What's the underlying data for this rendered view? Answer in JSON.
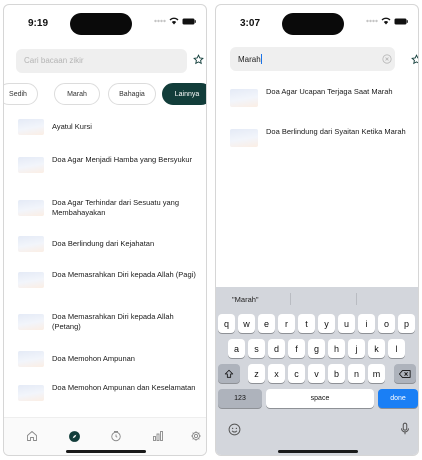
{
  "screen1": {
    "status_time": "9:19",
    "search_placeholder": "Cari bacaan zikir",
    "chips": [
      {
        "label": "Sedih"
      },
      {
        "label": "Marah"
      },
      {
        "label": "Bahagia"
      },
      {
        "label": "Lainnya",
        "active": true
      }
    ],
    "items": [
      {
        "title": "Ayatul Kursi"
      },
      {
        "title": "Doa Agar Menjadi Hamba yang Bersyukur"
      },
      {
        "title": "Doa Agar Terhindar dari Sesuatu yang Membahayakan"
      },
      {
        "title": "Doa Berlindung dari Kejahatan"
      },
      {
        "title": "Doa Memasrahkan Diri kepada Allah (Pagi)"
      },
      {
        "title": "Doa Memasrahkan Diri kepada Allah (Petang)"
      },
      {
        "title": "Doa Memohon Ampunan"
      },
      {
        "title": "Doa Memohon Ampunan dan Keselamatan"
      }
    ],
    "tabs": [
      {
        "icon": "home-icon"
      },
      {
        "icon": "compass-icon",
        "active": true
      },
      {
        "icon": "clock-icon"
      },
      {
        "icon": "stats-icon"
      },
      {
        "icon": "gear-icon"
      }
    ]
  },
  "screen2": {
    "status_time": "3:07",
    "search_value": "Marah",
    "results": [
      {
        "title": "Doa Agar Ucapan Terjaga Saat Marah"
      },
      {
        "title": "Doa Berlindung dari Syaitan Ketika Marah"
      }
    ],
    "keyboard": {
      "suggestion": "\"Marah\"",
      "row1": [
        "q",
        "w",
        "e",
        "r",
        "t",
        "y",
        "u",
        "i",
        "o",
        "p"
      ],
      "row2": [
        "a",
        "s",
        "d",
        "f",
        "g",
        "h",
        "j",
        "k",
        "l"
      ],
      "row3": [
        "z",
        "x",
        "c",
        "v",
        "b",
        "n",
        "m"
      ],
      "numbers_key": "123",
      "space_key": "space",
      "done_key": "done"
    }
  },
  "colors": {
    "active_chip": "#123d3a",
    "done_key": "#1a7ff5",
    "keyboard_bg": "#d3d6dc"
  }
}
